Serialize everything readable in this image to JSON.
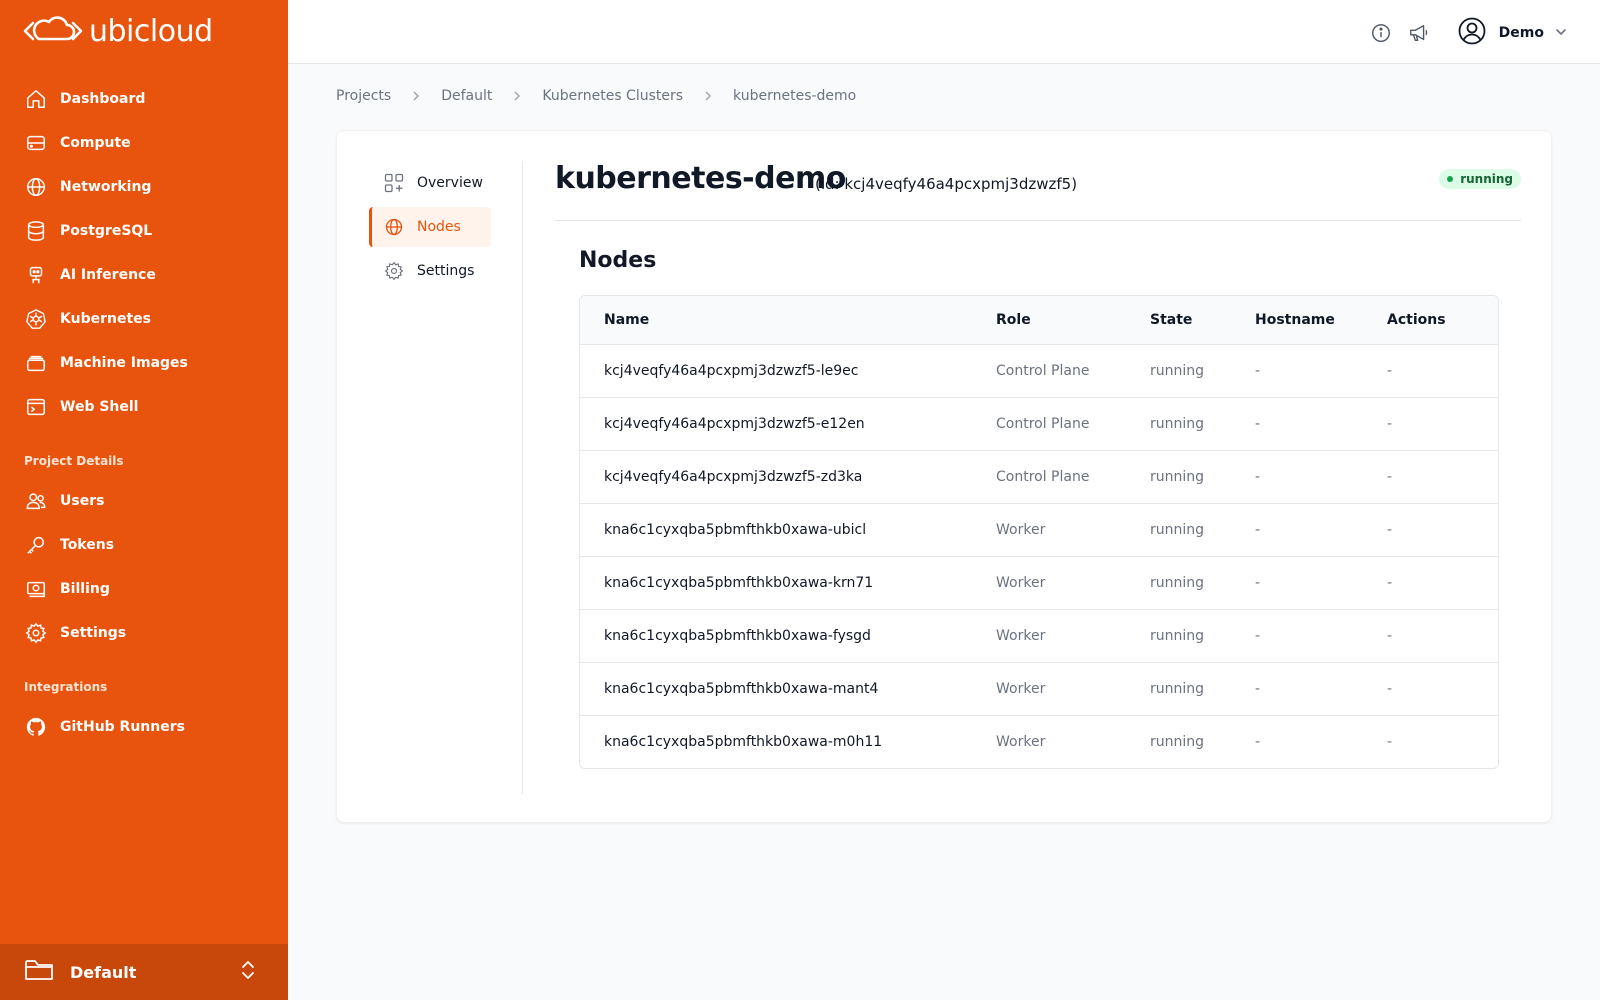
{
  "app": {
    "logo_text": "ubicloud"
  },
  "sidebar": {
    "items": [
      {
        "label": "Dashboard",
        "icon": "home-icon"
      },
      {
        "label": "Compute",
        "icon": "server-icon"
      },
      {
        "label": "Networking",
        "icon": "globe-icon"
      },
      {
        "label": "PostgreSQL",
        "icon": "database-icon"
      },
      {
        "label": "AI Inference",
        "icon": "robot-icon"
      },
      {
        "label": "Kubernetes",
        "icon": "kubernetes-icon"
      },
      {
        "label": "Machine Images",
        "icon": "stack-icon"
      },
      {
        "label": "Web Shell",
        "icon": "terminal-icon"
      }
    ],
    "project_section": {
      "title": "Project Details",
      "items": [
        {
          "label": "Users",
          "icon": "users-icon"
        },
        {
          "label": "Tokens",
          "icon": "key-icon"
        },
        {
          "label": "Billing",
          "icon": "banknote-icon"
        },
        {
          "label": "Settings",
          "icon": "gear-icon"
        }
      ]
    },
    "integrations_section": {
      "title": "Integrations",
      "items": [
        {
          "label": "GitHub Runners",
          "icon": "github-icon"
        }
      ]
    },
    "project_switcher": {
      "label": "Default"
    }
  },
  "header": {
    "user_name": "Demo"
  },
  "breadcrumb": [
    "Projects",
    "Default",
    "Kubernetes Clusters",
    "kubernetes-demo"
  ],
  "subnav": {
    "items": [
      {
        "label": "Overview",
        "icon": "overview-icon"
      },
      {
        "label": "Nodes",
        "icon": "globe-icon",
        "active": true
      },
      {
        "label": "Settings",
        "icon": "gear-icon"
      }
    ]
  },
  "cluster": {
    "name": "kubernetes-demo",
    "id_text": "(id: kcj4veqfy46a4pcxpmj3dzwzf5)",
    "status": "running"
  },
  "nodes": {
    "title": "Nodes",
    "columns": [
      "Name",
      "Role",
      "State",
      "Hostname",
      "Actions"
    ],
    "rows": [
      [
        "kcj4veqfy46a4pcxpmj3dzwzf5-le9ec",
        "Control Plane",
        "running",
        "-",
        "-"
      ],
      [
        "kcj4veqfy46a4pcxpmj3dzwzf5-e12en",
        "Control Plane",
        "running",
        "-",
        "-"
      ],
      [
        "kcj4veqfy46a4pcxpmj3dzwzf5-zd3ka",
        "Control Plane",
        "running",
        "-",
        "-"
      ],
      [
        "kna6c1cyxqba5pbmfthkb0xawa-ubicl",
        "Worker",
        "running",
        "-",
        "-"
      ],
      [
        "kna6c1cyxqba5pbmfthkb0xawa-krn71",
        "Worker",
        "running",
        "-",
        "-"
      ],
      [
        "kna6c1cyxqba5pbmfthkb0xawa-fysgd",
        "Worker",
        "running",
        "-",
        "-"
      ],
      [
        "kna6c1cyxqba5pbmfthkb0xawa-mant4",
        "Worker",
        "running",
        "-",
        "-"
      ],
      [
        "kna6c1cyxqba5pbmfthkb0xawa-m0h11",
        "Worker",
        "running",
        "-",
        "-"
      ]
    ]
  },
  "colors": {
    "brand": "#e8540d",
    "brand_dark": "#c8480b",
    "status_running_bg": "#dcfce7",
    "status_running_text": "#166534"
  }
}
